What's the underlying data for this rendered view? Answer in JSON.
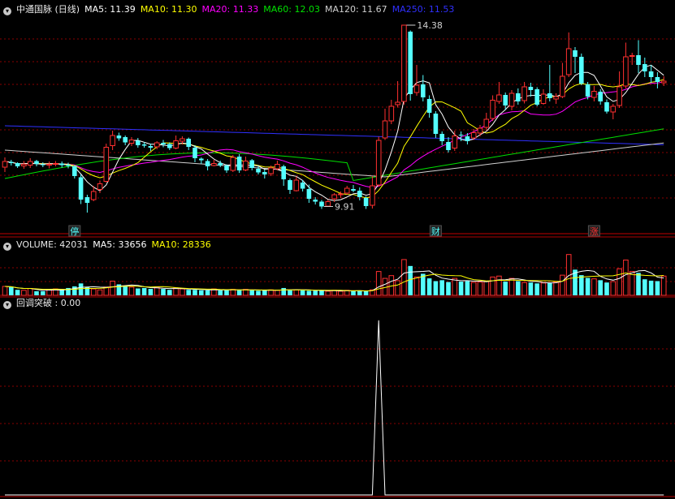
{
  "header": {
    "title": "中通国脉 (日线)",
    "ma": [
      {
        "label": "MA5: 11.39",
        "color": "#ffffff"
      },
      {
        "label": "MA10: 11.30",
        "color": "#ffff00"
      },
      {
        "label": "MA20: 11.33",
        "color": "#ff00ff"
      },
      {
        "label": "MA60: 12.03",
        "color": "#00e000"
      },
      {
        "label": "MA120: 11.67",
        "color": "#d0d0d0"
      },
      {
        "label": "MA250: 11.53",
        "color": "#3030ff"
      }
    ]
  },
  "volume_header": {
    "volume": "VOLUME: 42031",
    "ma5": "MA5: 33656",
    "ma10": "MA10: 28336"
  },
  "indicator_header": {
    "label": "回调突破 : 0.00"
  },
  "colors": {
    "up": "#ff3030",
    "down": "#54ffff",
    "grid": "#8a0000",
    "ma5": "#ffffff",
    "ma10": "#ffff00",
    "ma20": "#ff00ff",
    "ma60": "#00e000",
    "ma120": "#d0d0d0",
    "ma250": "#3030ff"
  },
  "chart_data": {
    "type": "candlestick",
    "price_ylim": [
      9.2,
      14.6
    ],
    "annotations": [
      {
        "text": "14.38",
        "index": 63,
        "value": 14.38
      },
      {
        "text": "9.91",
        "index": 50,
        "value": 9.91
      }
    ],
    "markers": [
      {
        "text": "停",
        "index": 11,
        "color": "#54ffff"
      },
      {
        "text": "财",
        "index": 68,
        "color": "#54ffff"
      },
      {
        "text": "涨",
        "index": 93,
        "color": "#ff3030"
      }
    ],
    "candles": [
      [
        10.88,
        11.02,
        11.12,
        10.76
      ],
      [
        11.01,
        10.98,
        11.06,
        10.92
      ],
      [
        10.98,
        10.9,
        11.0,
        10.86
      ],
      [
        10.91,
        10.95,
        11.03,
        10.84
      ],
      [
        10.93,
        11.02,
        11.1,
        10.86
      ],
      [
        11.03,
        10.96,
        11.06,
        10.9
      ],
      [
        10.95,
        10.93,
        11.0,
        10.88
      ],
      [
        10.93,
        10.95,
        11.02,
        10.85
      ],
      [
        10.96,
        10.97,
        11.03,
        10.9
      ],
      [
        10.97,
        10.93,
        11.02,
        10.87
      ],
      [
        10.94,
        10.91,
        10.99,
        10.85
      ],
      [
        10.9,
        10.66,
        10.93,
        10.6
      ],
      [
        10.63,
        10.08,
        10.7,
        9.97
      ],
      [
        10.14,
        10.0,
        10.2,
        9.76
      ],
      [
        10.08,
        10.28,
        10.42,
        10.04
      ],
      [
        10.33,
        10.47,
        10.55,
        10.24
      ],
      [
        10.53,
        11.37,
        11.46,
        10.5
      ],
      [
        11.41,
        11.66,
        11.78,
        11.3
      ],
      [
        11.66,
        11.59,
        11.73,
        11.53
      ],
      [
        11.62,
        11.49,
        11.66,
        11.42
      ],
      [
        11.47,
        11.55,
        11.62,
        11.4
      ],
      [
        11.53,
        11.42,
        11.6,
        11.36
      ],
      [
        11.44,
        11.41,
        11.5,
        11.36
      ],
      [
        11.4,
        11.36,
        11.46,
        11.28
      ],
      [
        11.38,
        11.48,
        11.52,
        11.32
      ],
      [
        11.48,
        11.44,
        11.55,
        11.37
      ],
      [
        11.45,
        11.35,
        11.49,
        11.3
      ],
      [
        11.35,
        11.53,
        11.66,
        11.32
      ],
      [
        11.52,
        11.58,
        11.64,
        11.44
      ],
      [
        11.58,
        11.38,
        11.61,
        11.3
      ],
      [
        11.36,
        11.1,
        11.42,
        11.0
      ],
      [
        11.09,
        11.05,
        11.12,
        10.96
      ],
      [
        11.03,
        10.9,
        11.08,
        10.8
      ],
      [
        10.92,
        10.97,
        11.06,
        10.9
      ],
      [
        10.98,
        10.92,
        11.04,
        10.88
      ],
      [
        10.92,
        10.8,
        10.95,
        10.74
      ],
      [
        10.8,
        11.12,
        11.18,
        10.76
      ],
      [
        11.14,
        10.8,
        11.2,
        10.74
      ],
      [
        10.81,
        11.03,
        11.14,
        10.78
      ],
      [
        11.05,
        10.86,
        11.08,
        10.8
      ],
      [
        10.84,
        10.75,
        10.9,
        10.7
      ],
      [
        10.76,
        10.7,
        10.82,
        10.6
      ],
      [
        10.72,
        10.86,
        10.92,
        10.66
      ],
      [
        10.84,
        10.95,
        11.04,
        10.8
      ],
      [
        10.9,
        10.58,
        10.94,
        10.42
      ],
      [
        10.56,
        10.32,
        10.6,
        10.22
      ],
      [
        10.3,
        10.56,
        10.65,
        10.28
      ],
      [
        10.5,
        10.35,
        10.56,
        10.28
      ],
      [
        10.34,
        10.1,
        10.45,
        10.0
      ],
      [
        10.08,
        10.03,
        10.14,
        9.96
      ],
      [
        10.03,
        9.91,
        10.07,
        9.85
      ],
      [
        9.92,
        10.03,
        10.08,
        9.9
      ],
      [
        10.1,
        10.2,
        10.24,
        10.02
      ],
      [
        10.2,
        10.22,
        10.28,
        10.12
      ],
      [
        10.24,
        10.36,
        10.42,
        10.2
      ],
      [
        10.34,
        10.3,
        10.44,
        10.26
      ],
      [
        10.3,
        10.14,
        10.38,
        10.06
      ],
      [
        10.12,
        9.92,
        10.16,
        9.85
      ],
      [
        9.94,
        10.42,
        10.66,
        9.86
      ],
      [
        10.44,
        11.54,
        11.63,
        10.4
      ],
      [
        11.6,
        12.02,
        12.32,
        11.55
      ],
      [
        12.02,
        12.38,
        12.54,
        11.94
      ],
      [
        12.42,
        12.48,
        13.0,
        12.35
      ],
      [
        12.5,
        14.38,
        14.38,
        12.42
      ],
      [
        14.22,
        12.68,
        14.25,
        12.52
      ],
      [
        12.72,
        12.9,
        13.4,
        12.64
      ],
      [
        12.92,
        12.6,
        13.15,
        12.5
      ],
      [
        12.56,
        12.22,
        12.65,
        12.1
      ],
      [
        12.2,
        11.7,
        12.26,
        11.6
      ],
      [
        11.7,
        11.52,
        11.76,
        11.42
      ],
      [
        11.5,
        11.3,
        11.62,
        11.24
      ],
      [
        11.35,
        11.65,
        11.78,
        11.28
      ],
      [
        11.68,
        11.66,
        11.76,
        11.52
      ],
      [
        11.64,
        11.52,
        11.72,
        11.44
      ],
      [
        11.6,
        11.73,
        11.82,
        11.55
      ],
      [
        11.72,
        11.84,
        11.92,
        11.64
      ],
      [
        11.86,
        12.06,
        12.22,
        11.78
      ],
      [
        12.08,
        12.53,
        12.65,
        12.02
      ],
      [
        12.5,
        12.66,
        12.98,
        12.44
      ],
      [
        12.66,
        12.4,
        12.72,
        12.3
      ],
      [
        12.38,
        12.7,
        12.78,
        12.28
      ],
      [
        12.7,
        12.5,
        12.82,
        12.42
      ],
      [
        12.52,
        12.86,
        12.98,
        12.45
      ],
      [
        12.86,
        12.78,
        12.96,
        12.62
      ],
      [
        12.8,
        12.42,
        12.85,
        12.38
      ],
      [
        12.45,
        12.68,
        12.8,
        12.42
      ],
      [
        12.7,
        12.58,
        13.4,
        12.5
      ],
      [
        12.56,
        12.62,
        12.7,
        12.44
      ],
      [
        12.62,
        13.12,
        13.45,
        12.58
      ],
      [
        13.16,
        13.8,
        14.2,
        13.1
      ],
      [
        13.76,
        13.6,
        13.84,
        13.2
      ],
      [
        13.6,
        12.94,
        13.68,
        12.9
      ],
      [
        12.92,
        12.62,
        12.98,
        12.55
      ],
      [
        12.6,
        12.75,
        12.88,
        12.5
      ],
      [
        12.74,
        12.5,
        12.8,
        12.42
      ],
      [
        12.48,
        12.25,
        12.55,
        12.2
      ],
      [
        12.24,
        12.38,
        12.44,
        12.06
      ],
      [
        12.4,
        12.86,
        13.24,
        12.34
      ],
      [
        12.88,
        13.6,
        13.95,
        12.82
      ],
      [
        13.62,
        13.63,
        13.7,
        13.4
      ],
      [
        13.64,
        13.4,
        14.01,
        13.2
      ],
      [
        13.42,
        13.24,
        13.58,
        13.1
      ],
      [
        13.24,
        13.1,
        13.4,
        12.96
      ],
      [
        13.1,
        12.98,
        13.22,
        12.82
      ],
      [
        12.96,
        13.0,
        13.12,
        12.88
      ]
    ],
    "volumes": [
      19500,
      18000,
      12000,
      11000,
      15000,
      9000,
      9000,
      13000,
      14000,
      12000,
      16000,
      19500,
      26000,
      18000,
      14000,
      12000,
      18000,
      31000,
      24000,
      21000,
      18000,
      15000,
      16000,
      14000,
      18000,
      14000,
      12000,
      16000,
      14000,
      12000,
      12000,
      11000,
      11000,
      14000,
      11000,
      11000,
      13000,
      11000,
      13000,
      11000,
      10000,
      11000,
      12000,
      11000,
      16000,
      11000,
      12000,
      11000,
      10000,
      10000,
      10000,
      9000,
      11000,
      9000,
      11000,
      9000,
      10000,
      9000,
      12000,
      52000,
      37000,
      43000,
      32000,
      78000,
      64000,
      40000,
      47000,
      37000,
      31000,
      33000,
      29000,
      37000,
      30000,
      31000,
      28000,
      29000,
      30000,
      40000,
      42000,
      30000,
      37000,
      31000,
      28000,
      28000,
      26000,
      27000,
      27000,
      29000,
      44000,
      89000,
      56000,
      44000,
      38000,
      36000,
      33000,
      28000,
      30000,
      58000,
      77000,
      52000,
      49000,
      35000,
      32000,
      31000,
      42031
    ],
    "volume_ylim": [
      0,
      92000
    ],
    "indicator": {
      "name": "回调突破",
      "spike_index": 59,
      "spike_value": 1,
      "ylim": [
        0,
        1.05
      ]
    }
  }
}
